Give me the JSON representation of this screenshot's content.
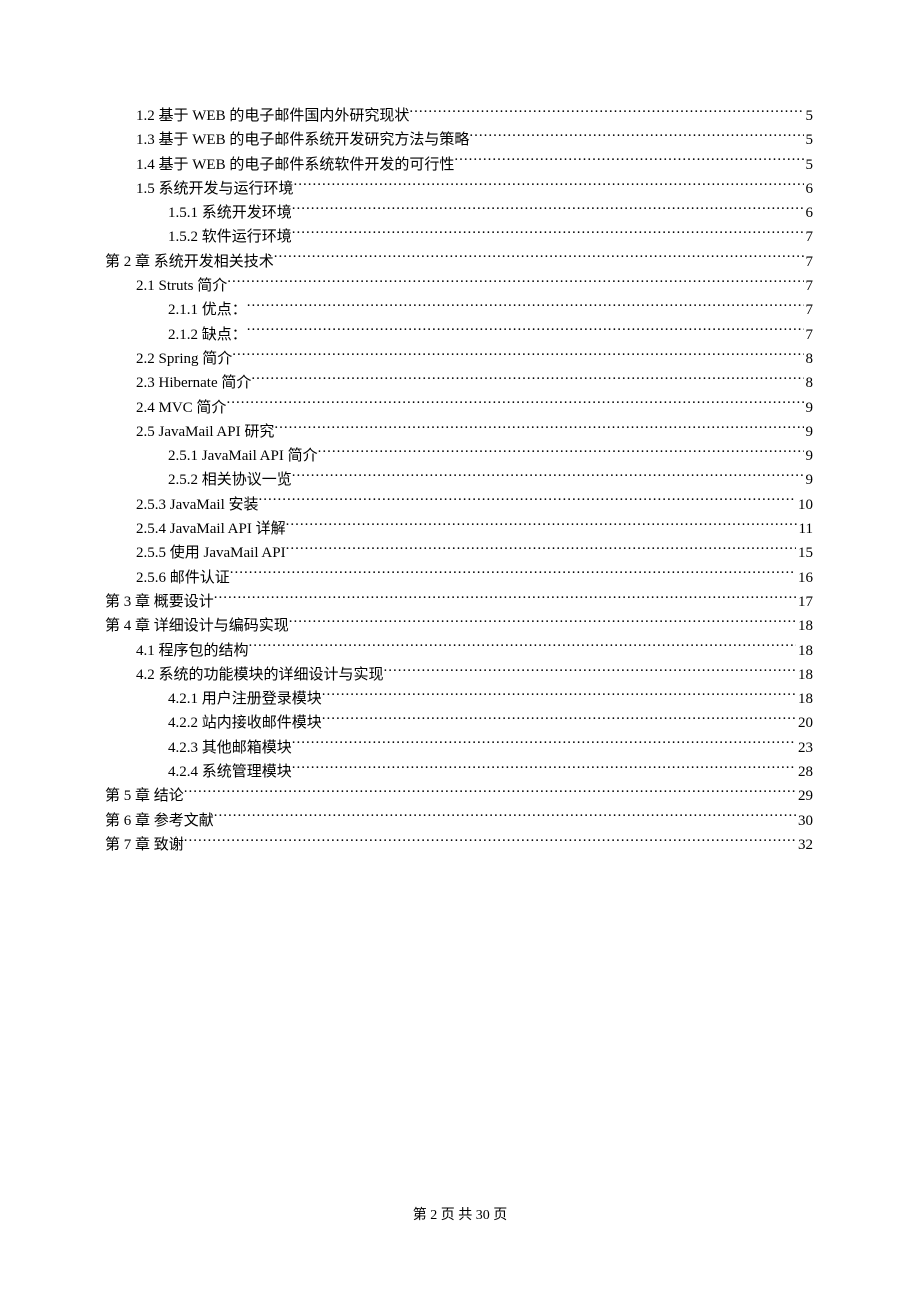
{
  "footer": "第 2 页 共 30 页",
  "toc": [
    {
      "indent": 1,
      "label": "1.2 基于 WEB 的电子邮件国内外研究现状",
      "page": "5"
    },
    {
      "indent": 1,
      "label": "1.3 基于 WEB 的电子邮件系统开发研究方法与策略",
      "page": "5"
    },
    {
      "indent": 1,
      "label": "1.4 基于 WEB 的电子邮件系统软件开发的可行性",
      "page": "5"
    },
    {
      "indent": 1,
      "label": "1.5 系统开发与运行环境",
      "page": "6"
    },
    {
      "indent": 2,
      "label": "1.5.1 系统开发环境",
      "page": "6"
    },
    {
      "indent": 2,
      "label": "1.5.2 软件运行环境",
      "page": "7"
    },
    {
      "indent": 0,
      "label": "第 2 章  系统开发相关技术",
      "page": "7"
    },
    {
      "indent": 1,
      "label": "2.1 Struts 简介",
      "page": "7"
    },
    {
      "indent": 2,
      "label": "2.1.1 优点：",
      "page": "7"
    },
    {
      "indent": 2,
      "label": "2.1.2 缺点：",
      "page": "7"
    },
    {
      "indent": 1,
      "label": "2.2 Spring 简介",
      "page": "8"
    },
    {
      "indent": 1,
      "label": "2.3 Hibernate 简介",
      "page": "8"
    },
    {
      "indent": 1,
      "label": "2.4 MVC 简介",
      "page": "9"
    },
    {
      "indent": 1,
      "label": "2.5 JavaMail API 研究",
      "page": "9"
    },
    {
      "indent": 2,
      "label": "2.5.1 JavaMail API 简介",
      "page": "9"
    },
    {
      "indent": 2,
      "label": "2.5.2 相关协议一览",
      "page": "9"
    },
    {
      "indent": 1,
      "label": "2.5.3 JavaMail 安装",
      "page": "10"
    },
    {
      "indent": 1,
      "label": "2.5.4 JavaMail API 详解",
      "page": "11"
    },
    {
      "indent": 1,
      "label": "2.5.5 使用 JavaMail API",
      "page": "15"
    },
    {
      "indent": 1,
      "label": "2.5.6 邮件认证",
      "page": "16"
    },
    {
      "indent": 0,
      "label": "第 3 章  概要设计",
      "page": "17"
    },
    {
      "indent": 0,
      "label": "第 4 章  详细设计与编码实现",
      "page": "18"
    },
    {
      "indent": 1,
      "label": "4.1 程序包的结构",
      "page": "18"
    },
    {
      "indent": 1,
      "label": "4.2 系统的功能模块的详细设计与实现",
      "page": "18"
    },
    {
      "indent": 2,
      "label": "4.2.1 用户注册登录模块",
      "page": "18"
    },
    {
      "indent": 2,
      "label": "4.2.2 站内接收邮件模块",
      "page": "20"
    },
    {
      "indent": 2,
      "label": "4.2.3 其他邮箱模块",
      "page": "23"
    },
    {
      "indent": 2,
      "label": "4.2.4 系统管理模块",
      "page": "28"
    },
    {
      "indent": 0,
      "label": "第 5 章  结论",
      "page": "29"
    },
    {
      "indent": 0,
      "label": "第 6 章  参考文献",
      "page": "30"
    },
    {
      "indent": 0,
      "label": "第 7 章  致谢",
      "page": "32"
    }
  ]
}
